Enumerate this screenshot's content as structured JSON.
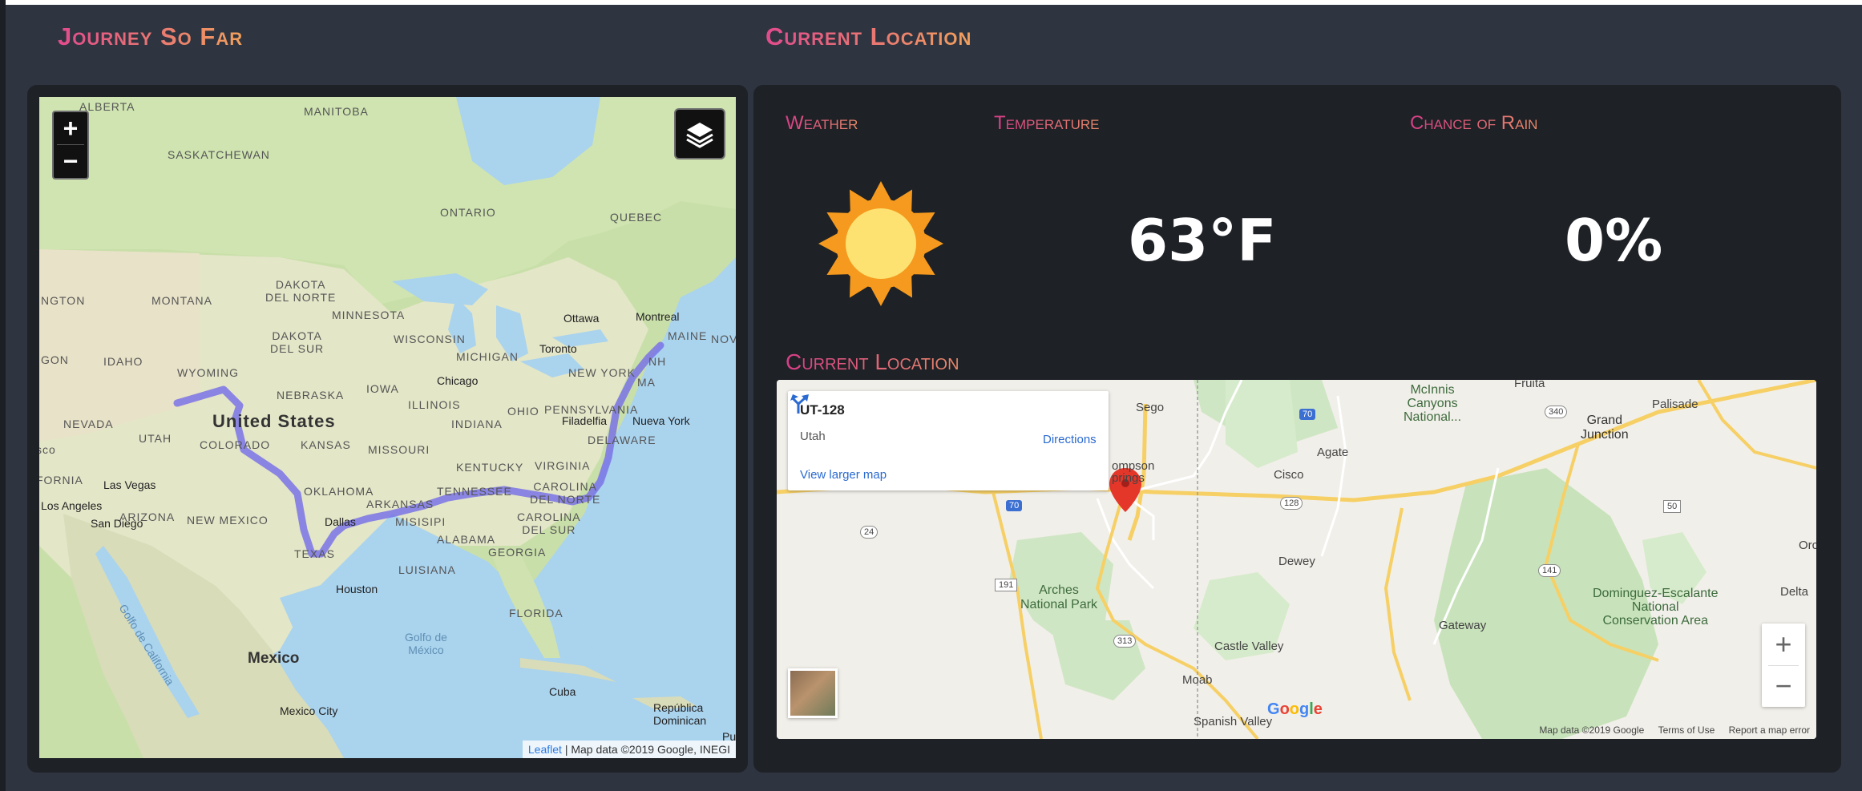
{
  "journey": {
    "heading": "Journey So Far",
    "zoom_in": "+",
    "zoom_out": "−",
    "layers_icon": "layers-icon",
    "attribution_link": "Leaflet",
    "attribution_text": "| Map data ©2019 Google, INEGI",
    "map_labels": {
      "alberta": "ALBERTA",
      "manitoba": "MANITOBA",
      "saskatchewan": "SASKATCHEWAN",
      "ontario": "ONTARIO",
      "quebec": "QUEBEC",
      "ngton": "NGTON",
      "montana": "MONTANA",
      "north_dakota": "DAKOTA\nDEL NORTE",
      "minnesota": "MINNESOTA",
      "ottawa": "Ottawa",
      "montreal": "Montreal",
      "maine": "MAINE",
      "nov": "NOV",
      "gon": "GON",
      "idaho": "IDAHO",
      "south_dakota": "DAKOTA\nDEL SUR",
      "wisconsin": "WISCONSIN",
      "michigan": "MICHIGAN",
      "toronto": "Toronto",
      "nh": "NH",
      "wyoming": "WYOMING",
      "new_york": "NEW YORK",
      "ma": "MA",
      "iowa": "IOWA",
      "chicago": "Chicago",
      "nebraska": "NEBRASKA",
      "illinois": "ILLINOIS",
      "ohio": "OHIO",
      "pennsylvania": "PENNSYLVANIA",
      "nevada": "NEVADA",
      "united_states": "United States",
      "indiana": "INDIANA",
      "filadelfia": "Filadelfia",
      "nueva_york": "Nueva York",
      "utah": "UTAH",
      "colorado": "COLORADO",
      "kansas": "KANSAS",
      "missouri": "MISSOURI",
      "delaware": "DELAWARE",
      "sco": "sco",
      "kentucky": "KENTUCKY",
      "virginia": "VIRGINIA",
      "fornia": "FORNIA",
      "las_vegas": "Las Vegas",
      "oklahoma": "OKLAHOMA",
      "tennessee": "TENNESSEE",
      "carolina_norte": "CAROLINA\nDEL NORTE",
      "arkansas": "ARKANSAS",
      "los_angeles": "Los Angeles",
      "arizona": "ARIZONA",
      "new_mexico": "NEW MEXICO",
      "mississippi": "MISISIPI",
      "carolina_sur": "CAROLINA\nDEL SUR",
      "san_diego": "San Diego",
      "dallas": "Dallas",
      "alabama": "ALABAMA",
      "georgia": "GEORGIA",
      "texas": "TEXAS",
      "louisiana": "LUISIANA",
      "houston": "Houston",
      "florida": "FLORIDA",
      "gulf_california": "Golfo de California",
      "gulf_mexico": "Golfo de\nMéxico",
      "mexico": "Mexico",
      "cuba": "Cuba",
      "mexico_city": "Mexico City",
      "dominican": "República\nDominican",
      "pue": "Pue"
    }
  },
  "current": {
    "heading": "Current Location",
    "weather_label": "Weather",
    "temperature_label": "Temperature",
    "rain_label": "Chance of Rain",
    "weather_icon": "sun-icon",
    "temperature_value": "63°F",
    "rain_value": "0%",
    "location_label": "Current Location"
  },
  "location_map": {
    "info_title": "UT-128",
    "info_subtitle": "Utah",
    "info_directions": "Directions",
    "info_larger": "View larger map",
    "zoom_in": "+",
    "zoom_out": "−",
    "labels": {
      "sego": "Sego",
      "thompson": "ompson\nprings",
      "agate": "Agate",
      "cisco": "Cisco",
      "dewey": "Dewey",
      "mcinnis": "McInnis\nCanyons\nNational...",
      "fruita": "Fruita",
      "palisade": "Palisade",
      "grand_junction": "Grand\nJunction",
      "arches": "Arches\nNational Park",
      "castle_valley": "Castle Valley",
      "moab": "Moab",
      "spanish_valley": "Spanish Valley",
      "gateway": "Gateway",
      "dominguez": "Dominguez-Escalante\nNational\nConservation Area",
      "delta": "Delta",
      "orc": "Orc",
      "r70a": "70",
      "r70b": "70",
      "r24": "24",
      "r128": "128",
      "r191": "191",
      "r313": "313",
      "r340": "340",
      "r50": "50",
      "r141": "141"
    },
    "google_logo": "Google",
    "footer_data": "Map data ©2019 Google",
    "footer_terms": "Terms of Use",
    "footer_report": "Report a map error"
  }
}
